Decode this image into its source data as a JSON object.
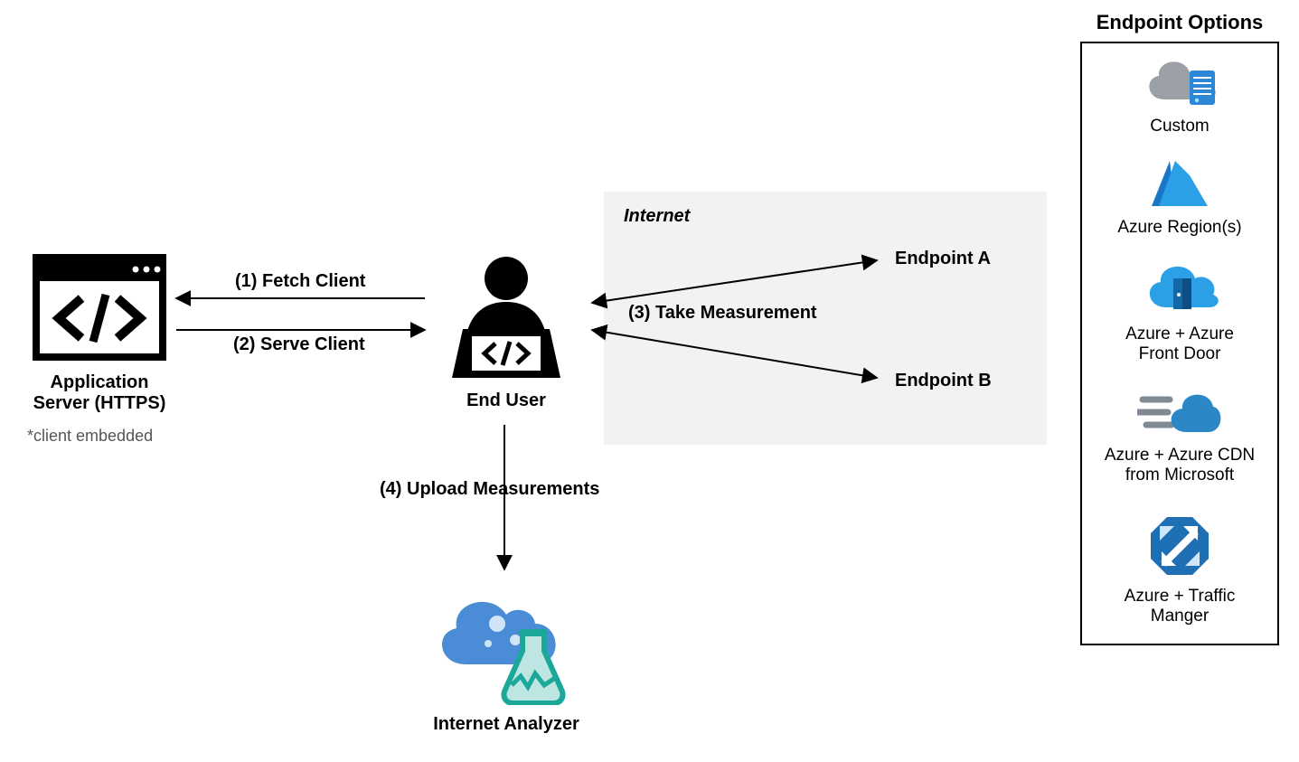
{
  "server": {
    "title": "Application\nServer (HTTPS)",
    "note": "*client embedded"
  },
  "end_user": {
    "label": "End User"
  },
  "internet": {
    "label": "Internet",
    "endpoint_a": "Endpoint A",
    "endpoint_b": "Endpoint B"
  },
  "steps": {
    "s1": "(1) Fetch Client",
    "s2": "(2) Serve Client",
    "s3": "(3) Take Measurement",
    "s4": "(4) Upload Measurements"
  },
  "analyzer": {
    "label": "Internet Analyzer"
  },
  "options": {
    "title": "Endpoint Options",
    "items": [
      "Custom",
      "Azure Region(s)",
      "Azure + Azure\nFront Door",
      "Azure + Azure CDN\nfrom Microsoft",
      "Azure + Traffic\nManger"
    ]
  }
}
